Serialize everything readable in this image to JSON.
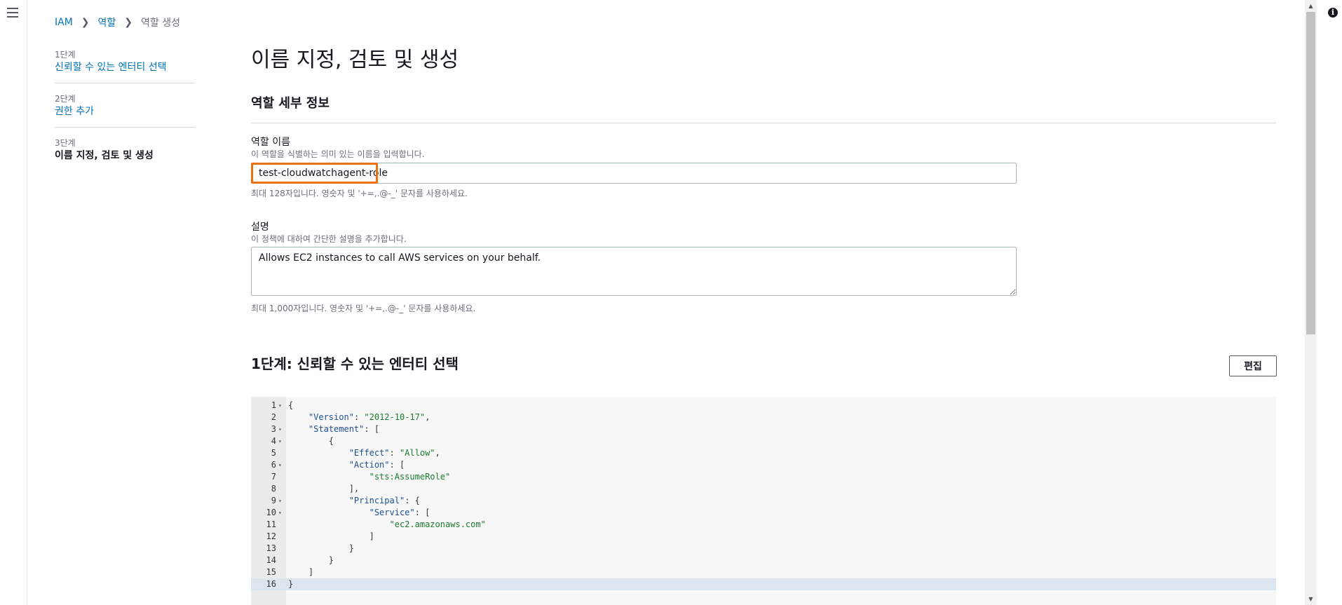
{
  "nav": {
    "menu_icon": "hamburger-menu-icon",
    "info_icon": "info-icon",
    "info_glyph": "i"
  },
  "breadcrumb": {
    "items": [
      "IAM",
      "역할",
      "역할 생성"
    ]
  },
  "wizard": {
    "steps": [
      {
        "num": "1단계",
        "title": "신뢰할 수 있는 엔터티 선택"
      },
      {
        "num": "2단계",
        "title": "권한 추가"
      },
      {
        "num": "3단계",
        "title": "이름 지정, 검토 및 생성"
      }
    ],
    "active_step": 3
  },
  "page": {
    "title": "이름 지정, 검토 및 생성",
    "section_title": "역할 세부 정보"
  },
  "role_name": {
    "label": "역할 이름",
    "hint": "이 역할을 식별하는 의미 있는 이름을 입력합니다.",
    "value": "test-cloudwatchagent-role",
    "constraint": "최대 128자입니다. 영숫자 및 '+=,.@-_' 문자를 사용하세요."
  },
  "description": {
    "label": "설명",
    "hint": "이 정책에 대하여 간단한 설명을 추가합니다.",
    "value": "Allows EC2 instances to call AWS services on your behalf.",
    "constraint": "최대 1,000자입니다. 영숫자 및 '+=,.@-_' 문자를 사용하세요."
  },
  "trust_section": {
    "title": "1단계: 신뢰할 수 있는 엔터티 선택",
    "edit_label": "편집"
  },
  "policy_editor": {
    "active_line": 16,
    "lines": [
      {
        "n": "1",
        "fold": true,
        "text": "{"
      },
      {
        "n": "2",
        "fold": false,
        "text": "    \"Version\": \"2012-10-17\","
      },
      {
        "n": "3",
        "fold": true,
        "text": "    \"Statement\": ["
      },
      {
        "n": "4",
        "fold": true,
        "text": "        {"
      },
      {
        "n": "5",
        "fold": false,
        "text": "            \"Effect\": \"Allow\","
      },
      {
        "n": "6",
        "fold": true,
        "text": "            \"Action\": ["
      },
      {
        "n": "7",
        "fold": false,
        "text": "                \"sts:AssumeRole\""
      },
      {
        "n": "8",
        "fold": false,
        "text": "            ],"
      },
      {
        "n": "9",
        "fold": true,
        "text": "            \"Principal\": {"
      },
      {
        "n": "10",
        "fold": true,
        "text": "                \"Service\": ["
      },
      {
        "n": "11",
        "fold": false,
        "text": "                    \"ec2.amazonaws.com\""
      },
      {
        "n": "12",
        "fold": false,
        "text": "                ]"
      },
      {
        "n": "13",
        "fold": false,
        "text": "            }"
      },
      {
        "n": "14",
        "fold": false,
        "text": "        }"
      },
      {
        "n": "15",
        "fold": false,
        "text": "    ]"
      },
      {
        "n": "16",
        "fold": false,
        "text": "}"
      }
    ]
  },
  "colors": {
    "link": "#0073bb",
    "highlight": "#ec7211"
  }
}
